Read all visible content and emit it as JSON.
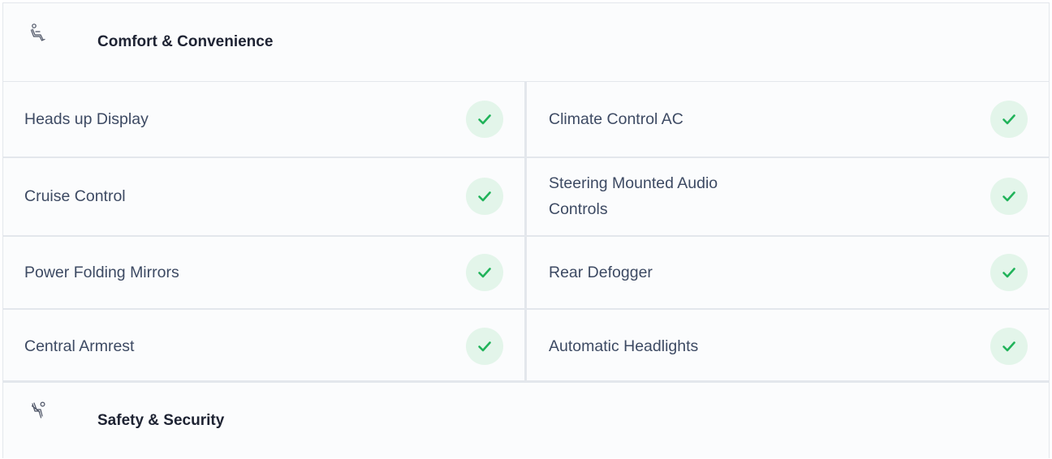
{
  "sections": {
    "comfort": {
      "title": "Comfort & Convenience",
      "icon": "seat-icon"
    },
    "safety": {
      "title": "Safety & Security",
      "icon": "seatbelt-icon"
    }
  },
  "features": [
    {
      "label": "Heads up Display",
      "available": true
    },
    {
      "label": "Climate Control AC",
      "available": true
    },
    {
      "label": "Cruise Control",
      "available": true
    },
    {
      "label": "Steering Mounted Audio Controls",
      "available": true
    },
    {
      "label": "Power Folding Mirrors",
      "available": true
    },
    {
      "label": "Rear Defogger",
      "available": true
    },
    {
      "label": "Central Armrest",
      "available": true
    },
    {
      "label": "Automatic Headlights",
      "available": true
    }
  ],
  "colors": {
    "check": "#21b35a",
    "check_bg": "#e3f5ea",
    "border": "#e3e7ec",
    "title": "#1e2333",
    "text": "#3d4a63"
  }
}
